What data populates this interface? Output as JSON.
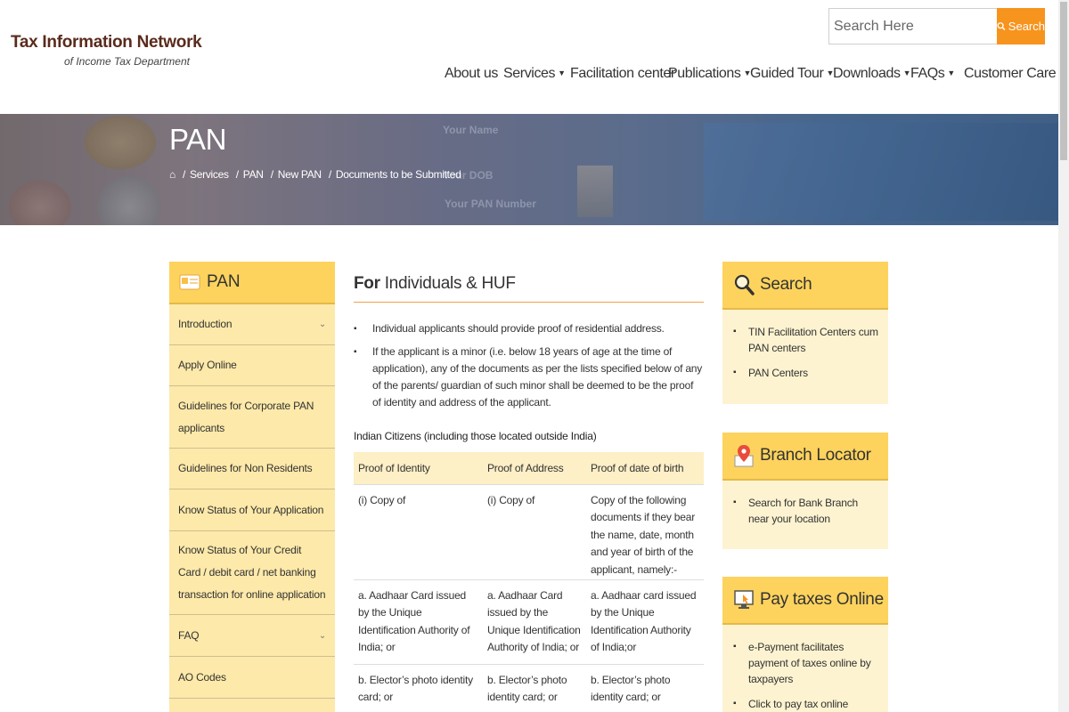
{
  "header": {
    "logo_title": "Tax Information Network",
    "logo_subtitle": "of Income Tax Department",
    "search_placeholder": "Search Here",
    "search_button": "Search"
  },
  "nav": [
    {
      "label": "About us",
      "dropdown": false
    },
    {
      "label": "Services",
      "dropdown": true
    },
    {
      "label": "Facilitation center",
      "dropdown": false
    },
    {
      "label": "Publications",
      "dropdown": true
    },
    {
      "label": "Guided Tour",
      "dropdown": true
    },
    {
      "label": "Downloads",
      "dropdown": true
    },
    {
      "label": "FAQs",
      "dropdown": true
    },
    {
      "label": "Customer Care",
      "dropdown": true
    }
  ],
  "banner": {
    "title": "PAN",
    "breadcrumb": [
      "Services",
      "PAN",
      "New PAN",
      "Documents to be Submitted"
    ],
    "card_name": "Your Name",
    "card_dob": "Your DOB",
    "card_pan": "Your PAN Number"
  },
  "leftnav": {
    "heading": "PAN",
    "items": [
      {
        "label": "Introduction",
        "expandable": true
      },
      {
        "label": "Apply Online",
        "expandable": false
      },
      {
        "label": "Guidelines for Corporate PAN applicants",
        "expandable": false
      },
      {
        "label": "Guidelines for Non Residents",
        "expandable": false
      },
      {
        "label": "Know Status of Your Application",
        "expandable": false
      },
      {
        "label": "Know Status of Your Credit Card / debit card / net banking transaction for online application",
        "expandable": false
      },
      {
        "label": "FAQ",
        "expandable": true
      },
      {
        "label": "AO Codes",
        "expandable": false
      }
    ]
  },
  "main": {
    "heading_bold": "For",
    "heading_rest": " Individuals & HUF",
    "bullets": [
      "Individual applicants should provide proof of residential address.",
      "If the applicant is a minor (i.e. below 18 years of age at the time of application), any of the documents as per the lists specified below of any of the parents/ guardian of such minor shall be deemed to be the proof of identity and address of the applicant."
    ],
    "subheading": "Indian Citizens (including those located outside India)",
    "table": {
      "headers": [
        "Proof of Identity",
        "Proof of Address",
        "Proof of date of birth"
      ],
      "rows": [
        [
          "(i) Copy of",
          "(i) Copy of",
          "Copy of the following documents if they bear the name, date, month and year of birth of the applicant, namely:-"
        ],
        [
          "a. Aadhaar Card issued by the Unique Identification Authority of India; or",
          "a. Aadhaar Card issued by the Unique Identification Authority of India; or",
          "a. Aadhaar card issued by the Unique Identification Authority of India;or"
        ],
        [
          "b. Elector’s photo identity card; or",
          "b. Elector’s photo identity card; or",
          "b. Elector’s photo identity card; or"
        ]
      ]
    }
  },
  "widgets": [
    {
      "title": "Search",
      "icon": "magnifier-icon",
      "items": [
        "TIN Facilitation Centers cum PAN centers",
        "PAN Centers"
      ]
    },
    {
      "title": "Branch Locator",
      "icon": "map-pin-icon",
      "items": [
        "Search for Bank Branch near your location"
      ]
    },
    {
      "title": "Pay taxes Online",
      "icon": "monitor-click-icon",
      "items": [
        "e-Payment facilitates payment of taxes online by taxpayers",
        "Click to pay tax online"
      ]
    }
  ],
  "colors": {
    "accent": "#f7941d",
    "widget_head": "#fdd35d",
    "panel": "#fde9a9",
    "brand": "#5a2b1c"
  }
}
